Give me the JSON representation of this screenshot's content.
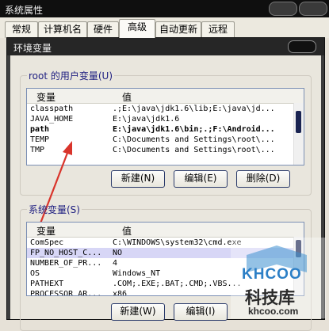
{
  "window": {
    "title": "系统属性"
  },
  "tabs": [
    {
      "label": "常规"
    },
    {
      "label": "计算机名"
    },
    {
      "label": "硬件"
    },
    {
      "label": "高级"
    },
    {
      "label": "自动更新"
    },
    {
      "label": "远程"
    }
  ],
  "dialog": {
    "title": "环境变量"
  },
  "user_vars": {
    "legend": "root 的用户变量(U)",
    "col_var": "变量",
    "col_val": "值",
    "rows": [
      {
        "name": "classpath",
        "value": ".;E:\\java\\jdk1.6\\lib;E:\\java\\jd..."
      },
      {
        "name": "JAVA_HOME",
        "value": "E:\\java\\jdk1.6"
      },
      {
        "name": "path",
        "value": "E:\\java\\jdk1.6\\bin;.;F:\\Android..."
      },
      {
        "name": "TEMP",
        "value": "C:\\Documents and Settings\\root\\..."
      },
      {
        "name": "TMP",
        "value": "C:\\Documents and Settings\\root\\..."
      }
    ],
    "btn_new": "新建(N)",
    "btn_edit": "编辑(E)",
    "btn_delete": "删除(D)"
  },
  "sys_vars": {
    "legend": "系统变量(S)",
    "col_var": "变量",
    "col_val": "值",
    "rows": [
      {
        "name": "ComSpec",
        "value": "C:\\WINDOWS\\system32\\cmd.exe"
      },
      {
        "name": "FP_NO_HOST_C...",
        "value": "NO"
      },
      {
        "name": "NUMBER_OF_PR...",
        "value": "4"
      },
      {
        "name": "OS",
        "value": "Windows_NT"
      },
      {
        "name": "PATHEXT",
        "value": ".COM;.EXE;.BAT;.CMD;.VBS..."
      },
      {
        "name": "PROCESSOR_AR...",
        "value": "x86"
      }
    ],
    "btn_new": "新建(W)",
    "btn_edit": "编辑(I)"
  },
  "watermark": {
    "brand": "KHCOO",
    "cn": "科技库",
    "url": "khcoo.com"
  },
  "colors": {
    "arrow": "#d9342b",
    "selection": "#d7d6f6",
    "title_bar": "#262626"
  }
}
